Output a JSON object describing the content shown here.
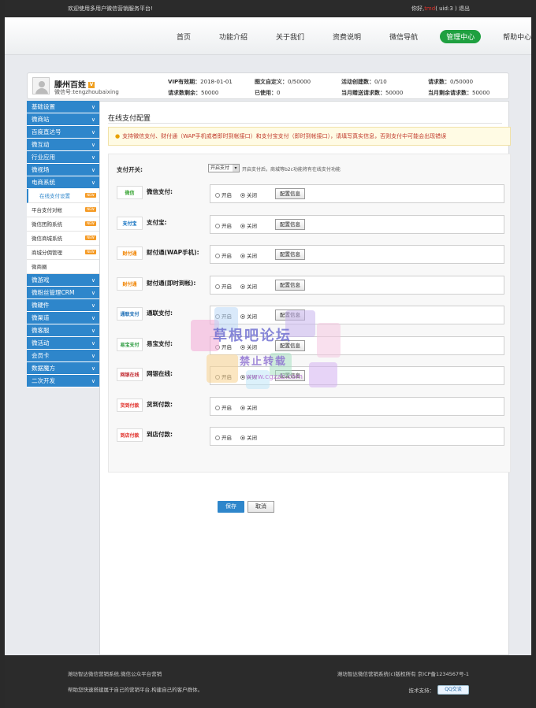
{
  "topbar": {
    "welcome": "欢迎使用多用户微信营销服务平台!",
    "greeting": "你好,",
    "user": "tmd",
    "uid": "( uid:3 )",
    "logout": "退出"
  },
  "nav": [
    "首页",
    "功能介绍",
    "关于我们",
    "资费说明",
    "微信导航",
    "管理中心",
    "帮助中心"
  ],
  "user": {
    "name": "滕州百姓",
    "vip_badge": "V",
    "wechat": "微信号:tengzhoubaixing",
    "stats": [
      {
        "label": "VIP有效期：",
        "value": "2018-01-01"
      },
      {
        "label": "图文自定义：",
        "value": "0/50000"
      },
      {
        "label": "活动创建数：",
        "value": "0/10"
      },
      {
        "label": "请求数：",
        "value": "0/50000"
      },
      {
        "label": "请求数剩余：",
        "value": "50000"
      },
      {
        "label": "已使用：",
        "value": "0"
      },
      {
        "label": "当月赠送请求数：",
        "value": "50000"
      },
      {
        "label": "当月剩余请求数：",
        "value": "50000"
      }
    ]
  },
  "sidebar": {
    "top_groups": [
      "基础设置",
      "微商站",
      "百度直达号",
      "微互动",
      "行业应用",
      "微视场",
      "电商系统"
    ],
    "subitems": [
      {
        "label": "在线支付设置",
        "badge": "NEW",
        "active": true
      },
      {
        "label": "平台支付对帐",
        "badge": "NEW"
      },
      {
        "label": "微信团购系统",
        "badge": "NEW"
      },
      {
        "label": "微信商城系统",
        "badge": "NEW"
      },
      {
        "label": "商城分佣管理",
        "badge": "NEW"
      },
      {
        "label": "微商圈",
        "badge": ""
      }
    ],
    "bottom_groups": [
      "微游戏",
      "微粉丝管理CRM",
      "微硬件",
      "微渠道",
      "微客服",
      "微活动",
      "会员卡",
      "数据魔方",
      "二次开发"
    ],
    "chevron": "∨"
  },
  "page": {
    "title": "在线支付配置",
    "notice": "支持微信支付、财付通（WAP手机或者即时到帐接口）和支付宝支付（即时到帐接口），请填写真实信息，否则支付中可能会出现错误",
    "switch_label": "支付开关:",
    "switch_value": "开启支付",
    "switch_hint": "开启支付后，商城等b2c功能将有在线支付功能",
    "on_label": "开启",
    "off_label": "关闭",
    "config_label": "配置信息",
    "save": "保存",
    "cancel": "取消"
  },
  "payments": [
    {
      "name": "微信支付:",
      "logo": "微信",
      "color": "#3aa535",
      "config": true
    },
    {
      "name": "支付宝:",
      "logo": "支付宝",
      "color": "#0a6cbe",
      "config": true
    },
    {
      "name": "财付通(WAP手机):",
      "logo": "财付通",
      "color": "#f08300",
      "config": true
    },
    {
      "name": "财付通(即时到帐):",
      "logo": "财付通",
      "color": "#f08300",
      "config": true
    },
    {
      "name": "通联支付:",
      "logo": "通联支付",
      "color": "#1b6db5",
      "config": true
    },
    {
      "name": "易宝支付:",
      "logo": "易宝支付",
      "color": "#2a9a3e",
      "config": true
    },
    {
      "name": "网银在线:",
      "logo": "网银在线",
      "color": "#c0282e",
      "config": true
    },
    {
      "name": "货到付款:",
      "logo": "货到付款",
      "color": "#e0302a",
      "config": false
    },
    {
      "name": "到店付款:",
      "logo": "到店付款",
      "color": "#e0302a",
      "config": false
    }
  ],
  "watermark": {
    "line1": "草根吧论坛",
    "line2": "禁止转载",
    "line3": "www.cgzzb.com"
  },
  "footer": {
    "left1": "潍坊智达微信营销系统,微信公众平台营销",
    "left2": "帮助您快速搭建属于自己的营销平台,构建自己的客户群体。",
    "right1": "潍坊智达微信营销系统(c)版权所有 京ICP备1234567号-1",
    "support": "技术支持：",
    "qq": "QQ交谈"
  }
}
